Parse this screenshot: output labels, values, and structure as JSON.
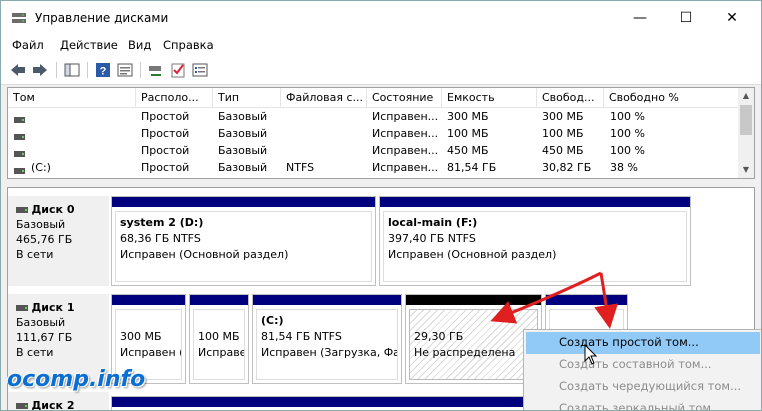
{
  "window": {
    "title": "Управление дисками",
    "controls": {
      "minimize": "—",
      "maximize": "☐",
      "close": "✕"
    }
  },
  "menu": [
    "Файл",
    "Действие",
    "Вид",
    "Справка"
  ],
  "toolbar_icons": [
    "back-icon",
    "forward-icon",
    "console-tree-icon",
    "help-icon",
    "properties-icon",
    "connect-icon",
    "check-icon",
    "list-icon"
  ],
  "volume_list": {
    "columns": [
      "Том",
      "Располо...",
      "Тип",
      "Файловая с...",
      "Состояние",
      "Емкость",
      "Свобод...",
      "Свободно %"
    ],
    "rows": [
      {
        "name": "",
        "layout": "Простой",
        "type": "Базовый",
        "fs": "",
        "status": "Исправен...",
        "capacity": "300 МБ",
        "free": "300 МБ",
        "free_pct": "100 %"
      },
      {
        "name": "",
        "layout": "Простой",
        "type": "Базовый",
        "fs": "",
        "status": "Исправен...",
        "capacity": "100 МБ",
        "free": "100 МБ",
        "free_pct": "100 %"
      },
      {
        "name": "",
        "layout": "Простой",
        "type": "Базовый",
        "fs": "",
        "status": "Исправен...",
        "capacity": "450 МБ",
        "free": "450 МБ",
        "free_pct": "100 %"
      },
      {
        "name": "(C:)",
        "layout": "Простой",
        "type": "Базовый",
        "fs": "NTFS",
        "status": "Исправен...",
        "capacity": "81,54 ГБ",
        "free": "30,82 ГБ",
        "free_pct": "38 %"
      }
    ]
  },
  "disks": [
    {
      "name": "Диск 0",
      "type": "Базовый",
      "size": "465,76 ГБ",
      "state": "В сети",
      "partitions": [
        {
          "title": "system 2  (D:)",
          "line2": "68,36 ГБ NTFS",
          "line3": "Исправен (Основной раздел)"
        },
        {
          "title": "local-main  (F:)",
          "line2": "397,40 ГБ NTFS",
          "line3": "Исправен (Основной раздел)"
        }
      ]
    },
    {
      "name": "Диск 1",
      "type": "Базовый",
      "size": "111,67 ГБ",
      "state": "В сети",
      "partitions": [
        {
          "title": "",
          "line2": "300 МБ",
          "line3": "Исправен ("
        },
        {
          "title": "",
          "line2": "100 МБ",
          "line3": "Исправе"
        },
        {
          "title": "(C:)",
          "line2": "81,54 ГБ NTFS",
          "line3": "Исправен (Загрузка, Фай"
        },
        {
          "title": "",
          "line2": "29,30 ГБ",
          "line3": "Не распределена"
        }
      ]
    },
    {
      "name": "Диск 2"
    }
  ],
  "context_menu": {
    "items": [
      "Создать простой том...",
      "Создать составной том...",
      "Создать чередующийся том...",
      "Создать зеркальный том..."
    ]
  },
  "watermark": "ocomp.info",
  "colors": {
    "partition_bar": "#00007f",
    "unallocated_bar": "#000000",
    "menu_highlight": "#91c9f7",
    "annotation_arrow": "#e02020"
  }
}
